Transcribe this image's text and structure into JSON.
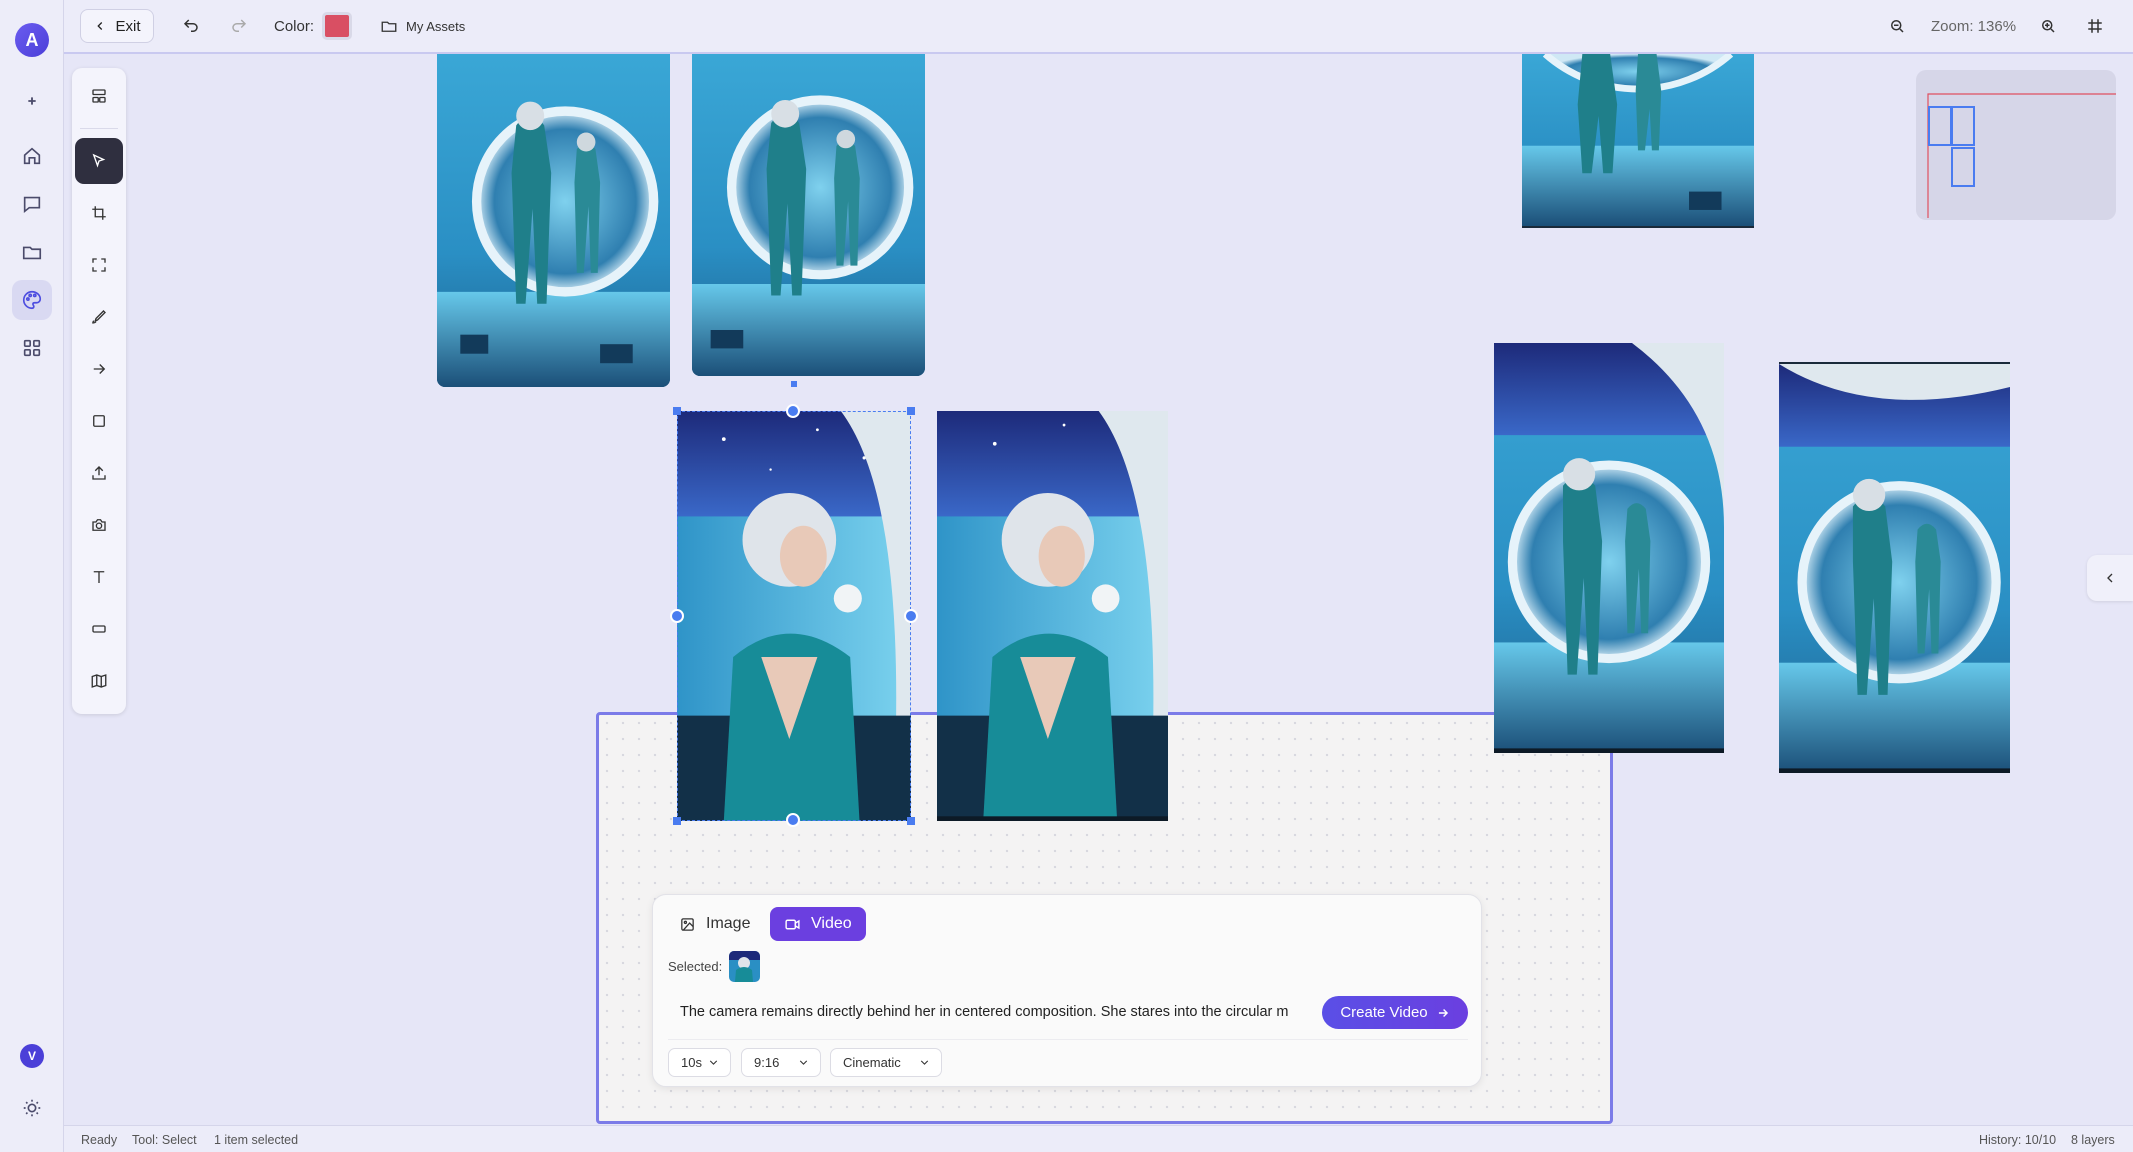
{
  "app": {
    "logo_letter": "A",
    "user_initial": "V"
  },
  "topbar": {
    "exit_label": "Exit",
    "color_label": "Color:",
    "color_value": "#d94f63",
    "assets_label": "My Assets",
    "zoom_label": "Zoom: 136%"
  },
  "tools": [
    "layers-icon",
    "select-icon",
    "crop-icon",
    "expand-icon",
    "brush-icon",
    "arrow-icon",
    "rectangle-icon",
    "upload-icon",
    "camera-icon",
    "text-icon",
    "frame-icon",
    "map-icon"
  ],
  "generator": {
    "tab_image": "Image",
    "tab_video": "Video",
    "active_tab": "Video",
    "selected_label": "Selected:",
    "prompt_text": "The camera remains directly behind her in centered composition. She stares into the circular m",
    "create_label": "Create Video",
    "duration": "10s",
    "aspect": "9:16",
    "style": "Cinematic"
  },
  "status": {
    "state": "Ready",
    "tool": "Tool: Select",
    "selection": "1 item selected",
    "history": "History: 10/10",
    "layers": "8 layers"
  },
  "colors": {
    "accent": "#6b3fe0",
    "selection": "#4a7cf0",
    "frame": "#7b7be8"
  }
}
